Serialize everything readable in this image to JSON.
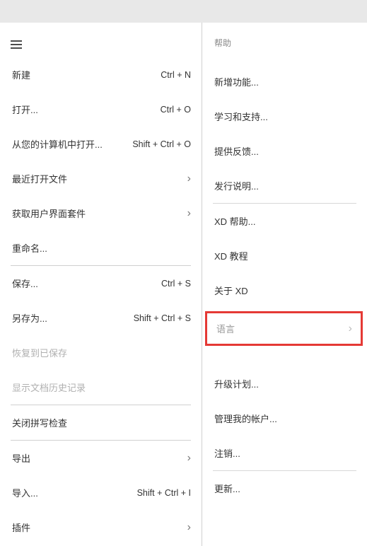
{
  "left": {
    "new": {
      "label": "新建",
      "shortcut": "Ctrl + N"
    },
    "open": {
      "label": "打开...",
      "shortcut": "Ctrl + O"
    },
    "openFromComputer": {
      "label": "从您的计算机中打开...",
      "shortcut": "Shift + Ctrl + O"
    },
    "recent": {
      "label": "最近打开文件"
    },
    "uiKits": {
      "label": "获取用户界面套件"
    },
    "rename": {
      "label": "重命名..."
    },
    "save": {
      "label": "保存...",
      "shortcut": "Ctrl + S"
    },
    "saveAs": {
      "label": "另存为...",
      "shortcut": "Shift + Ctrl + S"
    },
    "revert": {
      "label": "恢复到已保存"
    },
    "docHistory": {
      "label": "显示文档历史记录"
    },
    "spellCheck": {
      "label": "关闭拼写检查"
    },
    "export": {
      "label": "导出"
    },
    "import": {
      "label": "导入...",
      "shortcut": "Shift + Ctrl + I"
    },
    "plugins": {
      "label": "插件"
    }
  },
  "right": {
    "header": "帮助",
    "whatsNew": "新增功能...",
    "learnSupport": "学习和支持...",
    "feedback": "提供反馈...",
    "releaseNotes": "发行说明...",
    "xdHelp": "XD 帮助...",
    "xdTutorials": "XD 教程",
    "aboutXd": "关于 XD",
    "language": "语言",
    "upgradePlan": "升级计划...",
    "manageAccount": "管理我的帐户...",
    "signOut": "注销...",
    "updates": "更新..."
  }
}
